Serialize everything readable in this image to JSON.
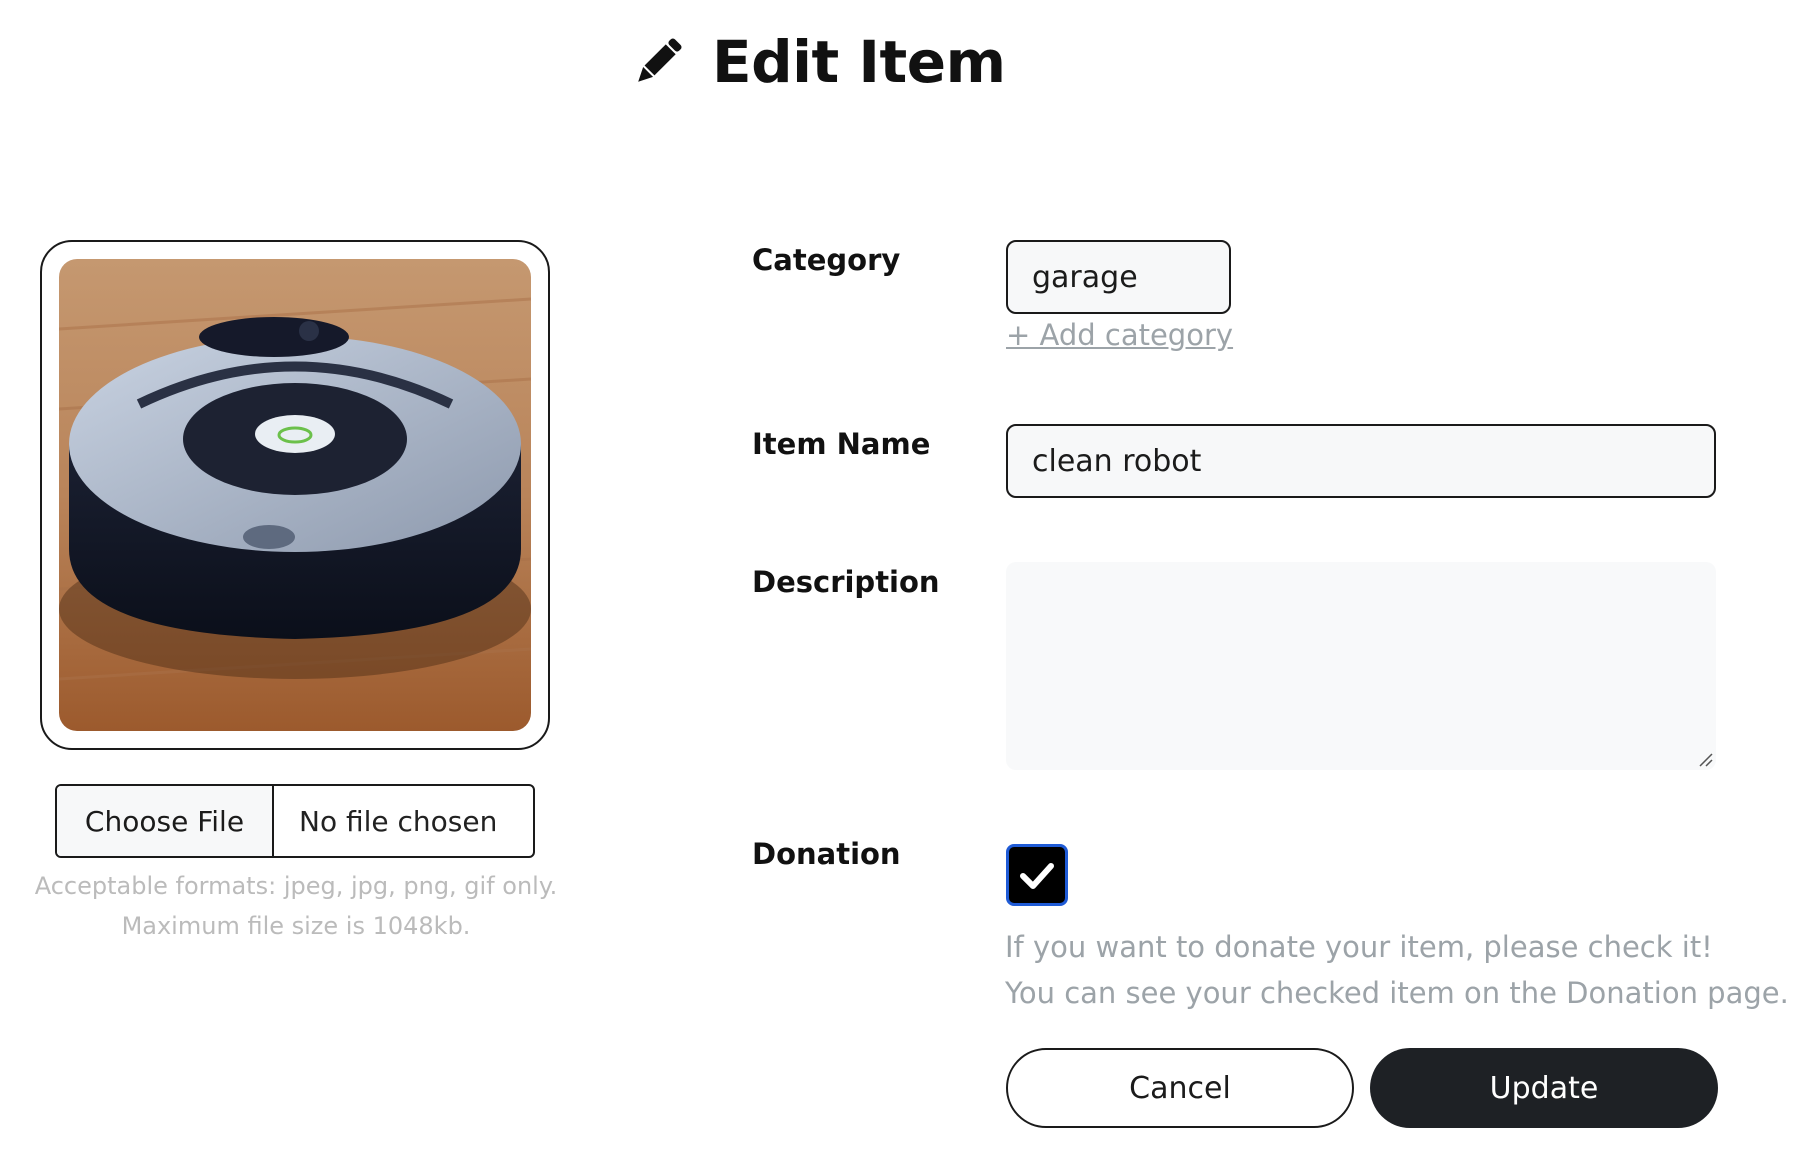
{
  "page": {
    "title": "Edit Item",
    "title_icon": "pencil-icon"
  },
  "image_panel": {
    "image_description": "robot-vacuum-photo",
    "choose_file_label": "Choose File",
    "file_status": "No file chosen",
    "hint_line1": "Acceptable formats: jpeg, jpg, png, gif only.",
    "hint_line2": "Maximum file size is 1048kb."
  },
  "form": {
    "category": {
      "label": "Category",
      "value": "garage",
      "add_link": "+ Add category"
    },
    "item_name": {
      "label": "Item Name",
      "value": "clean robot"
    },
    "description": {
      "label": "Description",
      "value": ""
    },
    "donation": {
      "label": "Donation",
      "checked": true,
      "hint_line1": "If you want to donate your item, please check it!",
      "hint_line2": "You can see your checked item on the Donation page."
    }
  },
  "actions": {
    "cancel_label": "Cancel",
    "update_label": "Update"
  },
  "colors": {
    "primary_button": "#1e2125",
    "checkbox_border": "#1f5bd6",
    "muted_text": "#9ca3a8",
    "input_background": "#f7f8f9"
  }
}
